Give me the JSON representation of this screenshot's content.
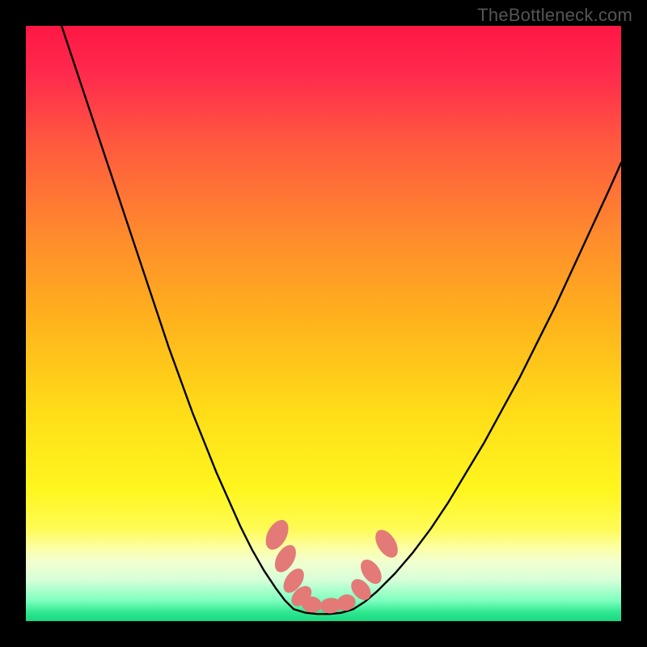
{
  "watermark": "TheBottleneck.com",
  "chart_data": {
    "type": "line",
    "title": "",
    "xlabel": "",
    "ylabel": "",
    "xlim": [
      0,
      100
    ],
    "ylim": [
      0,
      100
    ],
    "background_gradient": {
      "orientation": "vertical",
      "stops": [
        {
          "pos": 0.0,
          "color": "#ff1744"
        },
        {
          "pos": 0.08,
          "color": "#ff2a4d"
        },
        {
          "pos": 0.2,
          "color": "#ff5a3f"
        },
        {
          "pos": 0.35,
          "color": "#ff8a2d"
        },
        {
          "pos": 0.5,
          "color": "#ffb41c"
        },
        {
          "pos": 0.65,
          "color": "#ffdd18"
        },
        {
          "pos": 0.78,
          "color": "#fff61f"
        },
        {
          "pos": 0.845,
          "color": "#fffb55"
        },
        {
          "pos": 0.875,
          "color": "#fcffa0"
        },
        {
          "pos": 0.9,
          "color": "#f2ffd0"
        },
        {
          "pos": 0.93,
          "color": "#d8ffd8"
        },
        {
          "pos": 0.965,
          "color": "#7fffc0"
        },
        {
          "pos": 0.985,
          "color": "#30e890"
        },
        {
          "pos": 1.0,
          "color": "#18d880"
        }
      ]
    },
    "series": [
      {
        "name": "left-curve",
        "stroke": "#000000",
        "stroke_width": 2.4,
        "x": [
          6,
          8,
          10,
          12,
          14,
          16,
          18,
          20,
          22,
          24,
          26,
          28,
          30,
          32,
          34,
          36,
          38,
          40,
          42,
          43.5,
          45
        ],
        "y": [
          100,
          94,
          88,
          82,
          76,
          70,
          64,
          58,
          52,
          46,
          40.5,
          35,
          30,
          25,
          20.5,
          16,
          12,
          8.5,
          5.5,
          3.5,
          2
        ]
      },
      {
        "name": "right-curve",
        "stroke": "#000000",
        "stroke_width": 2.4,
        "x": [
          55,
          57,
          59,
          62,
          65,
          68,
          71,
          74,
          77,
          80,
          83,
          86,
          89,
          92,
          95,
          98,
          100
        ],
        "y": [
          2,
          3.3,
          5,
          8,
          11.5,
          15.5,
          20,
          25,
          30,
          35.5,
          41,
          47,
          53,
          59.5,
          66,
          72.5,
          77
        ]
      },
      {
        "name": "valley-floor",
        "stroke": "#000000",
        "stroke_width": 2.4,
        "x": [
          45,
          47,
          49,
          51,
          53,
          55
        ],
        "y": [
          2,
          1.4,
          1.2,
          1.2,
          1.4,
          2
        ]
      }
    ],
    "markers": [
      {
        "name": "left-marker-1",
        "cx": 42.2,
        "cy": 14.5,
        "rx": 1.6,
        "ry": 2.7,
        "rot": 28,
        "fill": "#e37a78"
      },
      {
        "name": "left-marker-2",
        "cx": 43.6,
        "cy": 10.5,
        "rx": 1.45,
        "ry": 2.5,
        "rot": 30,
        "fill": "#e37a78"
      },
      {
        "name": "left-marker-3",
        "cx": 45.0,
        "cy": 6.8,
        "rx": 1.35,
        "ry": 2.3,
        "rot": 35,
        "fill": "#e37a78"
      },
      {
        "name": "left-marker-4",
        "cx": 46.3,
        "cy": 4.2,
        "rx": 1.3,
        "ry": 2.0,
        "rot": 45,
        "fill": "#e37a78"
      },
      {
        "name": "floor-marker-1",
        "cx": 48.0,
        "cy": 2.8,
        "rx": 1.7,
        "ry": 1.35,
        "rot": 10,
        "fill": "#e37a78"
      },
      {
        "name": "floor-marker-2",
        "cx": 51.2,
        "cy": 2.6,
        "rx": 1.8,
        "ry": 1.3,
        "rot": -5,
        "fill": "#e37a78"
      },
      {
        "name": "floor-marker-3",
        "cx": 53.8,
        "cy": 3.1,
        "rx": 1.6,
        "ry": 1.35,
        "rot": -18,
        "fill": "#e37a78"
      },
      {
        "name": "right-marker-1",
        "cx": 56.3,
        "cy": 5.3,
        "rx": 1.35,
        "ry": 2.0,
        "rot": -40,
        "fill": "#e37a78"
      },
      {
        "name": "right-marker-2",
        "cx": 58.0,
        "cy": 8.3,
        "rx": 1.4,
        "ry": 2.3,
        "rot": -35,
        "fill": "#e37a78"
      },
      {
        "name": "right-marker-3",
        "cx": 60.6,
        "cy": 13.0,
        "rx": 1.5,
        "ry": 2.6,
        "rot": -32,
        "fill": "#e37a78"
      }
    ]
  }
}
